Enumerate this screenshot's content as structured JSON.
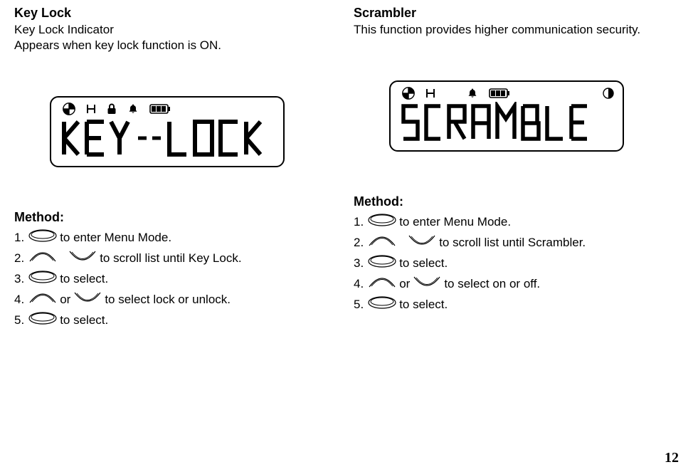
{
  "left": {
    "title": "Key Lock",
    "desc1": "Key Lock Indicator",
    "desc2": "Appears when key lock function is ON.",
    "method": "Method:",
    "steps": {
      "s1a": "1.",
      "s1b": " to enter Menu Mode.",
      "s2a": "2.",
      "s2b": "   to scroll list until Key Lock.",
      "s3a": "3.",
      "s3b": " to select.",
      "s4a": "4.",
      "s4mid": " or ",
      "s4b": " to select lock  or unlock.",
      "s5a": "5.",
      "s5b": " to select."
    }
  },
  "right": {
    "title": "Scrambler",
    "desc1": "This function provides higher communication security.",
    "method": "Method:",
    "steps": {
      "s1a": "1.",
      "s1b": " to enter Menu Mode.",
      "s2a": "2.",
      "s2b": "   to scroll list until Scrambler.",
      "s3a": "3.",
      "s3b": " to select.",
      "s4a": "4.",
      "s4mid": " or ",
      "s4b": " to select on or off.",
      "s5a": "5.",
      "s5b": " to select."
    }
  },
  "page": "12"
}
